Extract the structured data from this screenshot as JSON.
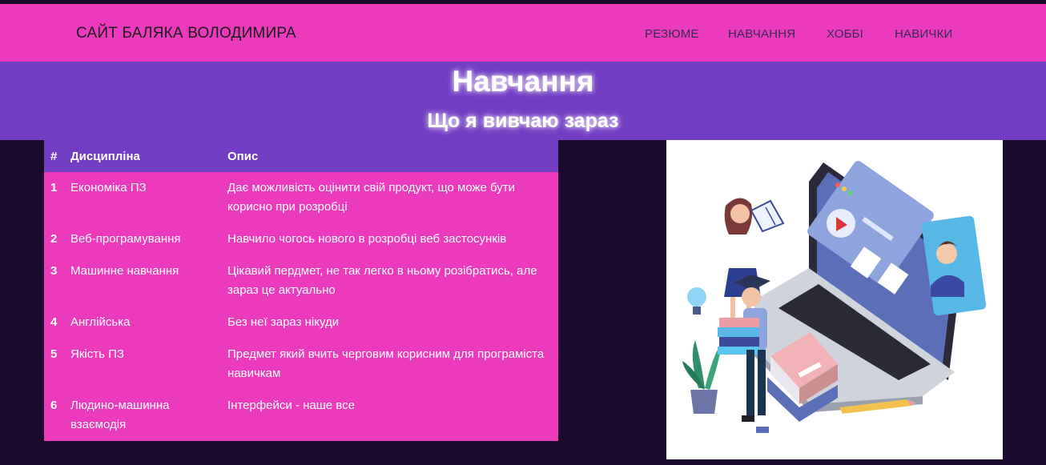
{
  "navbar": {
    "brand": "САЙТ БАЛЯКА ВОЛОДИМИРА",
    "links": [
      "РЕЗЮМЕ",
      "НАВЧАННЯ",
      "ХОББІ",
      "НАВИЧКИ"
    ]
  },
  "hero": {
    "title": "Навчання",
    "subtitle": "Що я вивчаю зараз"
  },
  "table": {
    "headers": [
      "#",
      "Дисципліна",
      "Опис"
    ],
    "rows": [
      {
        "num": "1",
        "discipline": "Економіка ПЗ",
        "description": "Дає можливість оцінити свій продукт, що може бути корисно при розробці"
      },
      {
        "num": "2",
        "discipline": "Веб-програмування",
        "description": "Навчило чогось нового в розробці веб застосунків"
      },
      {
        "num": "3",
        "discipline": "Машинне навчання",
        "description": "Цікавий пердмет, не так легко в ньому розібратись, але зараз це актуально"
      },
      {
        "num": "4",
        "discipline": "Англійська",
        "description": "Без неї зараз нікуди"
      },
      {
        "num": "5",
        "discipline": "Якість ПЗ",
        "description": "Предмет який вчить черговим корисним для програміста навичкам"
      },
      {
        "num": "6",
        "discipline": "Людино-машинна взаємодія",
        "description": "Інтерфейси - наше все"
      }
    ]
  },
  "colors": {
    "navbar_bg": "#eb3abb",
    "hero_bg": "#733dc4",
    "page_bg": "#190a2e"
  }
}
